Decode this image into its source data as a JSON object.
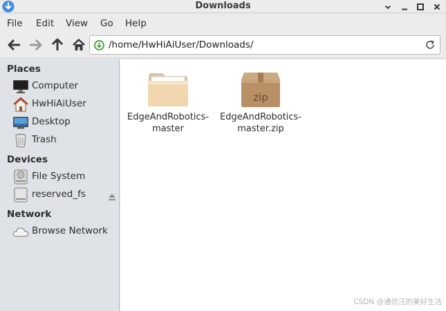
{
  "window": {
    "title": "Downloads"
  },
  "menu": [
    "File",
    "Edit",
    "View",
    "Go",
    "Help"
  ],
  "address": {
    "path": "/home/HwHiAiUser/Downloads/"
  },
  "sidebar": {
    "sections": {
      "places": "Places",
      "devices": "Devices",
      "network": "Network"
    },
    "places": [
      "Computer",
      "HwHiAiUser",
      "Desktop",
      "Trash"
    ],
    "devices": [
      "File System",
      "reserved_fs"
    ],
    "network": [
      "Browse Network"
    ]
  },
  "files": [
    {
      "name": "EdgeAndRobotics-\nmaster",
      "icon": "folder-icon"
    },
    {
      "name": "EdgeAndRobotics-\nmaster.zip",
      "icon": "zip-archive-icon",
      "badge": "zip"
    }
  ],
  "watermark": "CSDN @通信汪的美好生活",
  "colors": {
    "sidebar_bg": "#dfe3e8",
    "content_bg": "#ffffff",
    "chrome_bg": "#ececec"
  }
}
